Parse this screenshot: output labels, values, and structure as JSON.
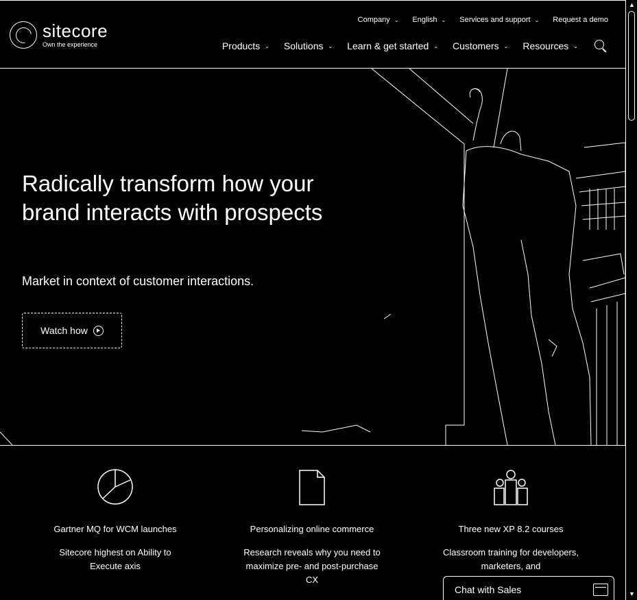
{
  "brand": {
    "name": "sitecore",
    "tagline": "Own the experience"
  },
  "utility_nav": [
    {
      "label": "Company"
    },
    {
      "label": "English"
    },
    {
      "label": "Services and support"
    },
    {
      "label": "Request a demo"
    }
  ],
  "main_nav": [
    {
      "label": "Products"
    },
    {
      "label": "Solutions"
    },
    {
      "label": "Learn & get started"
    },
    {
      "label": "Customers"
    },
    {
      "label": "Resources"
    }
  ],
  "hero": {
    "headline": "Radically transform how your brand interacts with prospects",
    "subhead": "Market in context of customer interactions.",
    "cta_label": "Watch how"
  },
  "features": [
    {
      "icon": "pie-chart-icon",
      "title": "Gartner MQ for WCM launches",
      "desc": "Sitecore highest on Ability to Execute axis"
    },
    {
      "icon": "document-icon",
      "title": "Personalizing online commerce",
      "desc": "Research reveals why you need to maximize pre- and post-purchase CX"
    },
    {
      "icon": "group-icon",
      "title": "Three new XP 8.2 courses",
      "desc": "Classroom training for developers, marketers, and"
    }
  ],
  "chat": {
    "label": "Chat with Sales"
  }
}
